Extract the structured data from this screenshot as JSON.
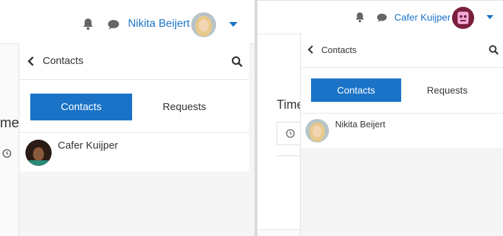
{
  "left": {
    "user_name": "Nikita Beijert",
    "panel_title": "Contacts",
    "tabs": [
      {
        "label": "Contacts",
        "active": true
      },
      {
        "label": "Requests",
        "active": false
      }
    ],
    "contacts": [
      {
        "name": "Cafer Kuijper"
      }
    ],
    "partial_text": "me"
  },
  "right": {
    "user_name": "Cafer Kuijper",
    "panel_title": "Contacts",
    "tabs": [
      {
        "label": "Contacts",
        "active": true
      },
      {
        "label": "Requests",
        "active": false
      }
    ],
    "contacts": [
      {
        "name": "Nikita Beijert"
      }
    ],
    "partial_text": "Time"
  },
  "colors": {
    "accent": "#1a73c7"
  }
}
